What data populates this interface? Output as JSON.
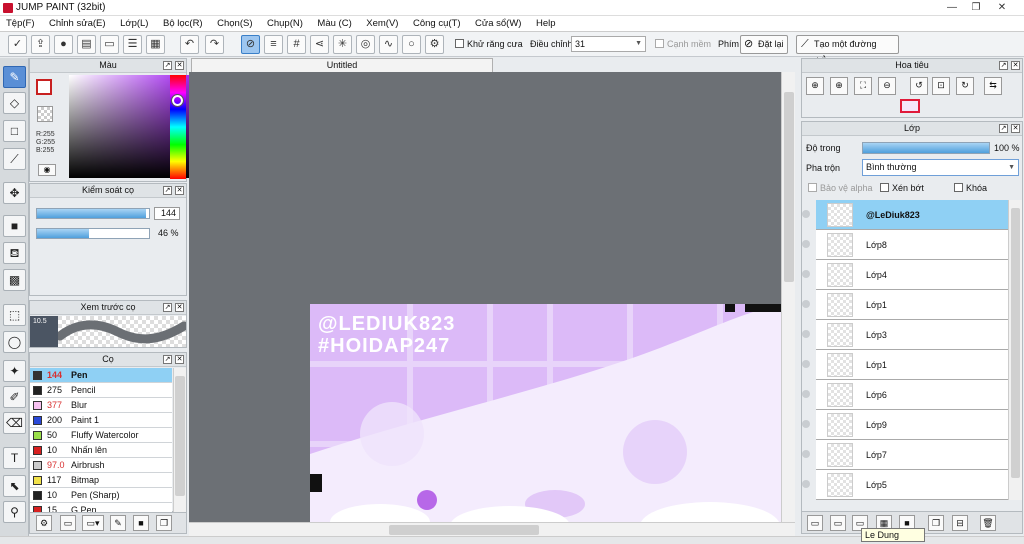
{
  "app": {
    "title": "JUMP PAINT (32bit)"
  },
  "menu": [
    "Tệp(F)",
    "Chỉnh sửa(E)",
    "Lớp(L)",
    "Bộ lọc(R)",
    "Chọn(S)",
    "Chụp(N)",
    "Màu (C)",
    "Xem(V)",
    "Công cụ(T)",
    "Cửa sổ(W)",
    "Help"
  ],
  "toolbar": {
    "antialias_label": "Khử răng cưa",
    "adjust_label": "Điều chỉnh",
    "adjust_value": "31",
    "smooth_label": "Cạnh mềm",
    "key_label": "Phím",
    "reset_label": "Đặt lại",
    "straight_line_label": "Tạo một đường thẳng"
  },
  "color_panel": {
    "title": "Màu",
    "r": "R:255",
    "g": "G:255",
    "b": "B:255"
  },
  "brush_control": {
    "title": "Kiểm soát cọ",
    "size_value": "144",
    "size_fraction": 0.97,
    "opacity_value": "46 %",
    "opacity_fraction": 0.46
  },
  "brush_preview": {
    "title": "Xem trước cọ",
    "size_label": "10.5"
  },
  "brush_list": {
    "title": "Cọ",
    "items": [
      {
        "size": "144",
        "name": "Pen",
        "color": "#333333",
        "size_color": "#d83030",
        "selected": true
      },
      {
        "size": "275",
        "name": "Pencil",
        "color": "#222222",
        "size_color": "#111111",
        "selected": false
      },
      {
        "size": "377",
        "name": "Blur",
        "color": "#f7c1f1",
        "size_color": "#d83030",
        "selected": false
      },
      {
        "size": "200",
        "name": "Paint 1",
        "color": "#2a49d8",
        "size_color": "#111111",
        "selected": false
      },
      {
        "size": "50",
        "name": "Fluffy Watercolor",
        "color": "#9be04a",
        "size_color": "#111111",
        "selected": false
      },
      {
        "size": "10",
        "name": "Nhấn lên",
        "color": "#d82020",
        "size_color": "#111111",
        "selected": false
      },
      {
        "size": "97.0",
        "name": "Airbrush",
        "color": "#cccccc",
        "size_color": "#d83030",
        "selected": false
      },
      {
        "size": "117",
        "name": "Bitmap",
        "color": "#f2e24a",
        "size_color": "#111111",
        "selected": false
      },
      {
        "size": "10",
        "name": "Pen (Sharp)",
        "color": "#222222",
        "size_color": "#111111",
        "selected": false
      },
      {
        "size": "15",
        "name": "G Pen",
        "color": "#d82020",
        "size_color": "#111111",
        "selected": false
      }
    ]
  },
  "canvas": {
    "tab_title": "Untitled",
    "watermark1": "@LEDIUK823",
    "watermark2": "#HOIDAP247"
  },
  "navigator": {
    "title": "Hoa tiêu"
  },
  "layers": {
    "title": "Lớp",
    "opacity_label": "Độ trong",
    "opacity_value": "100 %",
    "opacity_fraction": 1.0,
    "blend_label": "Pha trộn",
    "blend_value": "Bình thường",
    "protect_alpha": "Bảo vệ alpha",
    "clipping": "Xén bớt",
    "lock": "Khóa",
    "items": [
      {
        "name": "@LeDiuk823",
        "selected": true
      },
      {
        "name": "Lớp8",
        "selected": false
      },
      {
        "name": "Lớp4",
        "selected": false
      },
      {
        "name": "Lớp1",
        "selected": false
      },
      {
        "name": "Lớp3",
        "selected": false
      },
      {
        "name": "Lớp1",
        "selected": false
      },
      {
        "name": "Lớp6",
        "selected": false
      },
      {
        "name": "Lớp9",
        "selected": false
      },
      {
        "name": "Lớp7",
        "selected": false
      },
      {
        "name": "Lớp5",
        "selected": false
      }
    ]
  },
  "tooltip": {
    "text": "Le Dung"
  },
  "colors": {
    "accent": "#8fd0f4",
    "canvas_bg": "#6c7075",
    "artwork": "#d9b8f7"
  }
}
